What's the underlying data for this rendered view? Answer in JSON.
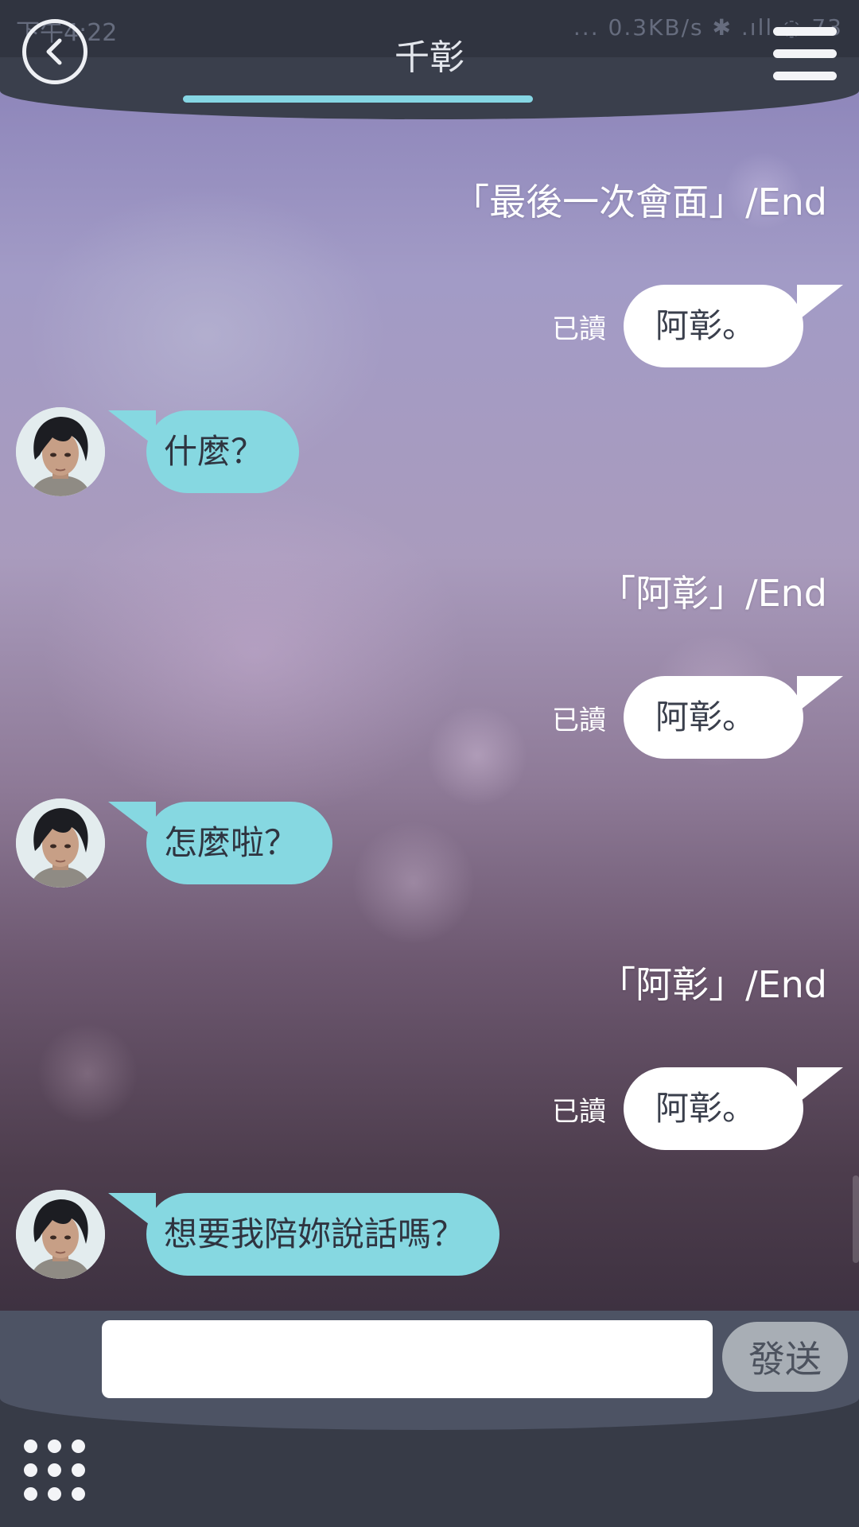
{
  "status_bar": {
    "left": "下午4:22",
    "right": "... 0.3KB/s ✱ .ıll ◌ 73"
  },
  "header": {
    "title": "千彰",
    "accent_color": "#86d6e4"
  },
  "messages": [
    {
      "type": "end",
      "text": "「最後一次會面」/End"
    },
    {
      "type": "out",
      "read": "已讀",
      "text": "阿彰。"
    },
    {
      "type": "in",
      "text": "什麼？"
    },
    {
      "type": "end",
      "text": "「阿彰」/End"
    },
    {
      "type": "out",
      "read": "已讀",
      "text": "阿彰。"
    },
    {
      "type": "in",
      "text": "怎麼啦？"
    },
    {
      "type": "end",
      "text": "「阿彰」/End"
    },
    {
      "type": "out",
      "read": "已讀",
      "text": "阿彰。"
    },
    {
      "type": "in",
      "text": "想要我陪妳說話嗎？"
    }
  ],
  "composer": {
    "value": "",
    "send_label": "發送"
  },
  "colors": {
    "incoming_bubble": "#86d8e1",
    "outgoing_bubble": "#ffffff",
    "bar": "#3a3f4c"
  },
  "icons": {
    "back": "chevron-left-icon",
    "menu": "hamburger-menu-icon",
    "apps": "grid-dots-icon"
  }
}
